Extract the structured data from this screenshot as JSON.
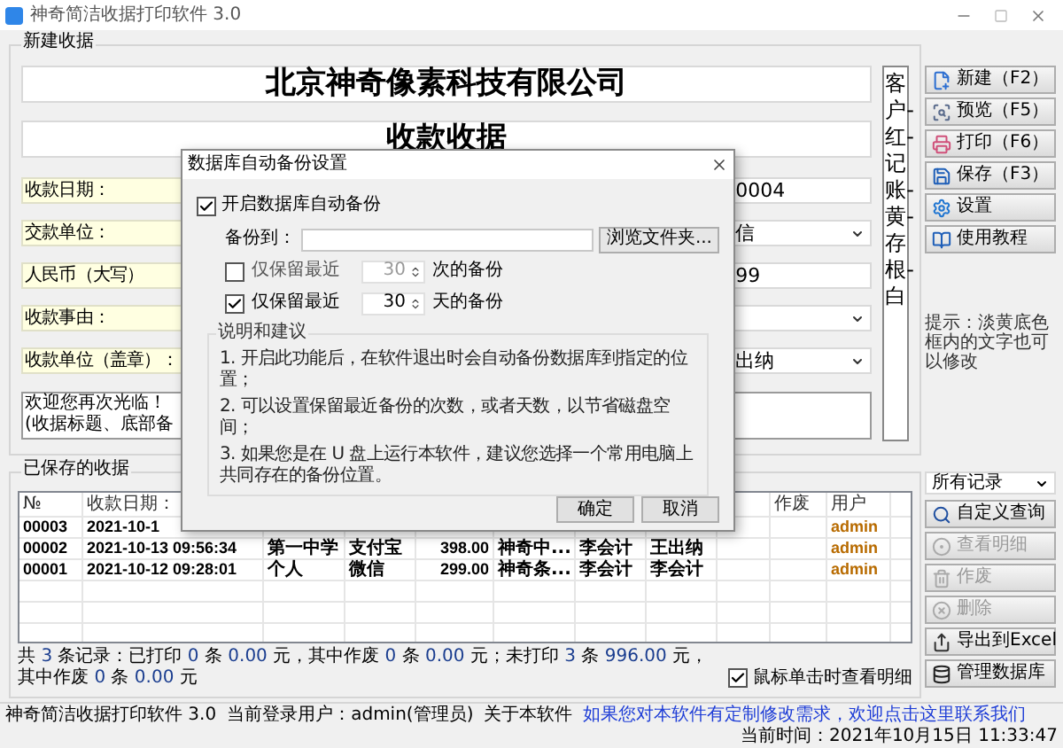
{
  "window": {
    "title": "神奇简洁收据打印软件 3.0"
  },
  "new_receipt": {
    "title": "新建收据",
    "company": "北京神奇像素科技有限公司",
    "heading": "收款收据",
    "fields": [
      {
        "label": "收款日期：",
        "value": "0004",
        "kind": "text"
      },
      {
        "label": "交款单位：",
        "value": "信",
        "kind": "select"
      },
      {
        "label": "人民币（大写）",
        "value": "99",
        "kind": "text"
      },
      {
        "label": "收款事由：",
        "kind": "select"
      },
      {
        "label": "收款单位（盖章）：",
        "value": "出纳",
        "kind": "select"
      }
    ],
    "note_lines": [
      "欢迎您再次光临！",
      "(收据标题、底部备"
    ],
    "copies_strip": "客户-红-记账-黄-存根-白"
  },
  "actions": [
    {
      "label": "新建（F2）",
      "kind": "new"
    },
    {
      "label": "预览（F5）",
      "kind": "preview"
    },
    {
      "label": "打印（F6）",
      "kind": "print"
    },
    {
      "label": "保存（F3）",
      "kind": "save"
    },
    {
      "label": "设置",
      "kind": "settings"
    },
    {
      "label": "使用教程",
      "kind": "tutorial"
    }
  ],
  "tip": "提示：淡黄底色框内的文字也可以修改",
  "saved": {
    "title": "已保存的收据",
    "columns": [
      {
        "label": "№"
      },
      {
        "label": "收款日期："
      },
      {},
      {},
      {},
      {},
      {},
      {},
      {},
      {
        "label": "作废"
      },
      {
        "label": "用户"
      }
    ],
    "rows": [
      {
        "cells": [
          "00003",
          "2021-10-1",
          null,
          null,
          null,
          null,
          null,
          null,
          null,
          null,
          "admin"
        ]
      },
      {
        "cells": [
          "00002",
          "2021-10-13 09:56:34",
          "第一中学",
          "支付宝",
          "398.00",
          "神奇中...",
          "李会计",
          "王出纳",
          null,
          null,
          "admin"
        ]
      },
      {
        "cells": [
          "00001",
          "2021-10-12 09:28:01",
          "个人",
          "微信",
          "299.00",
          "神奇条...",
          "李会计",
          "李会计",
          null,
          null,
          "admin"
        ]
      }
    ],
    "summary": [
      {
        "text": "共 ",
        "kind": "plain"
      },
      {
        "text": "3",
        "kind": "number"
      },
      {
        "text": " 条记录：已打印 ",
        "kind": "plain"
      },
      {
        "text": "0",
        "kind": "number"
      },
      {
        "text": " 条 ",
        "kind": "plain"
      },
      {
        "text": "0.00",
        "kind": "number"
      },
      {
        "text": " 元，其中作废 ",
        "kind": "plain"
      },
      {
        "text": "0",
        "kind": "number"
      },
      {
        "text": " 条 ",
        "kind": "plain"
      },
      {
        "text": "0.00",
        "kind": "number"
      },
      {
        "text": " 元；未打印 ",
        "kind": "plain"
      },
      {
        "text": "3",
        "kind": "number"
      },
      {
        "text": " 条 ",
        "kind": "plain"
      },
      {
        "text": "996.00",
        "kind": "number"
      },
      {
        "text": " 元，其中作废 ",
        "kind": "plain"
      },
      {
        "text": "0",
        "kind": "number"
      },
      {
        "text": " 条 ",
        "kind": "plain"
      },
      {
        "text": "0.00",
        "kind": "number"
      },
      {
        "text": " 元",
        "kind": "plain"
      }
    ],
    "click_detail": {
      "label": "鼠标单击时查看明细",
      "checked": true
    }
  },
  "filter": {
    "value": "所有记录"
  },
  "list_actions": [
    {
      "label": "自定义查询",
      "kind": "search",
      "disabled": false
    },
    {
      "label": "查看明细",
      "kind": "detail",
      "disabled": true
    },
    {
      "label": "作废",
      "kind": "void",
      "disabled": true
    },
    {
      "label": "删除",
      "kind": "delete",
      "disabled": true
    },
    {
      "label": "导出到Excel",
      "kind": "export",
      "disabled": false
    },
    {
      "label": "管理数据库",
      "kind": "database",
      "disabled": false
    }
  ],
  "status_bar": {
    "app": "神奇简洁收据打印软件 3.0",
    "user": "当前登录用户：admin(管理员)",
    "about": "关于本软件",
    "link": "如果您对本软件有定制修改需求，欢迎点击这里联系我们",
    "time": "当前时间：2021年10月15日 11:33:47"
  },
  "dialog": {
    "title": "数据库自动备份设置",
    "enable": {
      "label": "开启数据库自动备份",
      "checked": true
    },
    "path_label": "备份到：",
    "browse": "浏览文件夹...",
    "keep_rules": [
      {
        "label": "仅保留最近",
        "checked": false,
        "value": "30",
        "unit": "次的备份"
      },
      {
        "label": "仅保留最近",
        "checked": true,
        "value": "30",
        "unit": "天的备份"
      }
    ],
    "notes_title": "说明和建议",
    "notes": [
      "1. 开启此功能后，在软件退出时会自动备份数据库到指定的位置；",
      "2. 可以设置保留最近备份的次数，或者天数，以节省磁盘空间；",
      "3. 如果您是在 U 盘上运行本软件，建议您选择一个常用电脑上共同存在的备份位置。"
    ],
    "buttons": [
      "确定",
      "取消"
    ]
  }
}
